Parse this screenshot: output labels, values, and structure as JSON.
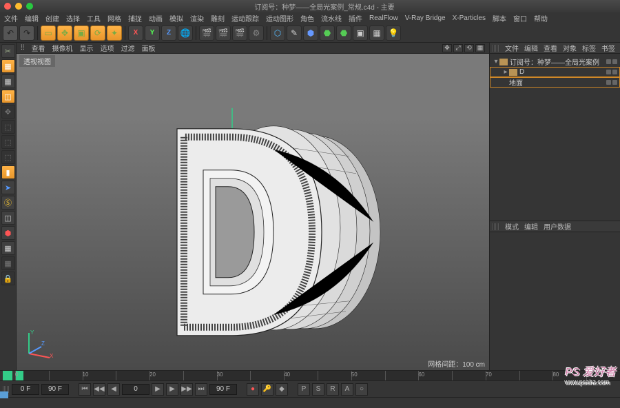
{
  "window": {
    "title": "订阅号：种梦——全局光案例_常规.c4d - 主要"
  },
  "menu": {
    "items": [
      "文件",
      "编辑",
      "创建",
      "选择",
      "工具",
      "网格",
      "捕捉",
      "动画",
      "模拟",
      "渲染",
      "雕刻",
      "运动跟踪",
      "运动图形",
      "角色",
      "流水线",
      "插件",
      "RealFlow",
      "V-Ray Bridge",
      "X-Particles",
      "脚本",
      "窗口",
      "帮助"
    ]
  },
  "vpmenu": {
    "items": [
      "查看",
      "摄像机",
      "显示",
      "选项",
      "过滤",
      "面板"
    ]
  },
  "viewport": {
    "label": "透视视图",
    "grid_info": "网格间距：100 cm"
  },
  "objpanel": {
    "tabs": [
      "文件",
      "编辑",
      "查看",
      "对象",
      "标签",
      "书签"
    ],
    "rows": [
      {
        "icon": "lo",
        "name": "订阅号：种梦——全局光案例",
        "depth": 0,
        "expand": "▾",
        "hl": false
      },
      {
        "icon": "lo2",
        "name": "D",
        "depth": 1,
        "expand": "▸",
        "hl": true
      },
      {
        "icon": "floor",
        "name": "地面",
        "depth": 1,
        "expand": "",
        "hl": true
      }
    ]
  },
  "attrpanel": {
    "tabs": [
      "模式",
      "编辑",
      "用户数据"
    ]
  },
  "timeline": {
    "start": "0 F",
    "end": "90 F",
    "curstart": "0",
    "curend": "90 F",
    "range": 90
  },
  "toolbar_hints": {
    "undo": "↶",
    "redo": "↷",
    "sel": "▭",
    "move": "✥",
    "scale": "▣",
    "rotate": "⟳",
    "last": "✦",
    "x": "X",
    "y": "Y",
    "z": "Z",
    "world": "🌐",
    "render": "🎬",
    "rv": "🎬",
    "rr": "🎬",
    "rs": "⚙",
    "prim": "⬡",
    "pen": "✎",
    "def": "⬢",
    "env": "⬣",
    "cam": "▣",
    "light": "💡",
    "scene": "▦"
  },
  "watermark": {
    "text": "PS 爱好者",
    "url": "www.psahz.com"
  }
}
